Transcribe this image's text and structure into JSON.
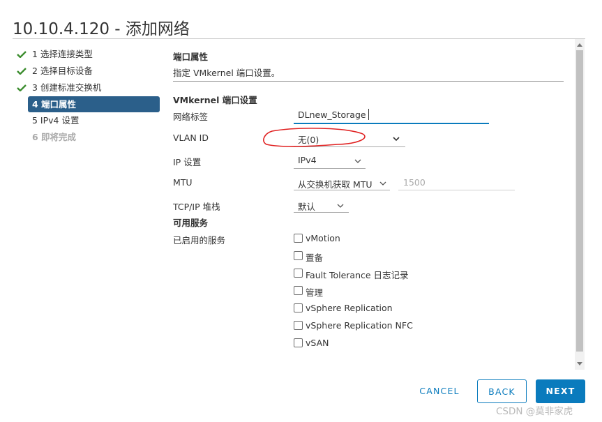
{
  "window": {
    "title": "10.10.4.120 - 添加网络"
  },
  "steps": [
    {
      "label": "1 选择连接类型",
      "state": "done"
    },
    {
      "label": "2 选择目标设备",
      "state": "done"
    },
    {
      "label": "3 创建标准交换机",
      "state": "done"
    },
    {
      "label": "4 端口属性",
      "state": "active"
    },
    {
      "label": "5 IPv4 设置",
      "state": "pending"
    },
    {
      "label": "6 即将完成",
      "state": "disabled"
    }
  ],
  "section": {
    "title": "端口属性",
    "subtitle": "指定 VMkernel 端口设置。"
  },
  "vmk": {
    "heading": "VMkernel 端口设置",
    "network_label": {
      "label": "网络标签",
      "value": "DLnew_Storage"
    },
    "vlan": {
      "label": "VLAN ID",
      "value": "无(0)"
    },
    "ip": {
      "label": "IP 设置",
      "value": "IPv4"
    },
    "mtu": {
      "label": "MTU",
      "value": "从交换机获取 MTU",
      "number_placeholder": "1500"
    },
    "tcpip": {
      "label": "TCP/IP 堆栈",
      "value": "默认"
    }
  },
  "services": {
    "heading": "可用服务",
    "enabled_label": "已启用的服务",
    "items": [
      {
        "label": "vMotion",
        "checked": false
      },
      {
        "label": "置备",
        "checked": false
      },
      {
        "label": "Fault Tolerance 日志记录",
        "checked": false
      },
      {
        "label": "管理",
        "checked": false
      },
      {
        "label": "vSphere Replication",
        "checked": false
      },
      {
        "label": "vSphere Replication NFC",
        "checked": false
      },
      {
        "label": "vSAN",
        "checked": false
      }
    ]
  },
  "buttons": {
    "cancel": "CANCEL",
    "back": "BACK",
    "next": "NEXT"
  },
  "watermark": "CSDN @莫非家虎",
  "colors": {
    "accent": "#0a7bbd",
    "active_step": "#2b5f8a",
    "check": "#3c8d2f",
    "annotation": "#e02020"
  }
}
